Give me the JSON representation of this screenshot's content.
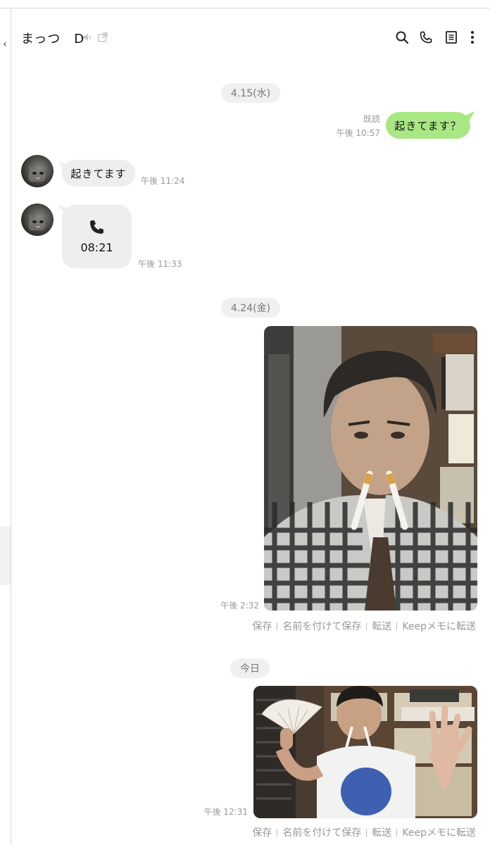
{
  "header": {
    "title": "まっつ　D",
    "icons": [
      "mute-speaker-icon",
      "external-window-icon",
      "search-icon",
      "phone-icon",
      "notes-icon",
      "more-vertical-icon"
    ]
  },
  "sidebar": {
    "collapse_glyph": "‹"
  },
  "messages": {
    "date1": "4.15(水)",
    "sent1": {
      "text": "起きてます？",
      "read": "既読",
      "time": "午後 10:57"
    },
    "recv1": {
      "text": "起きてます",
      "time": "午後 11:24"
    },
    "call1": {
      "duration": "08:21",
      "time": "午後 11:33"
    },
    "date2": "4.24(金)",
    "photo1": {
      "time": "午後 2:32"
    },
    "date3": "今日",
    "photo2": {
      "time": "午後 12:31"
    }
  },
  "photo_actions": [
    "保存",
    "名前を付けて保存",
    "転送",
    "Keepメモに転送"
  ],
  "colors": {
    "sent_bubble": "#a9e784",
    "recv_bubble": "#eeeeee",
    "date_pill": "#f0f0f0",
    "meta_text": "#999999"
  }
}
